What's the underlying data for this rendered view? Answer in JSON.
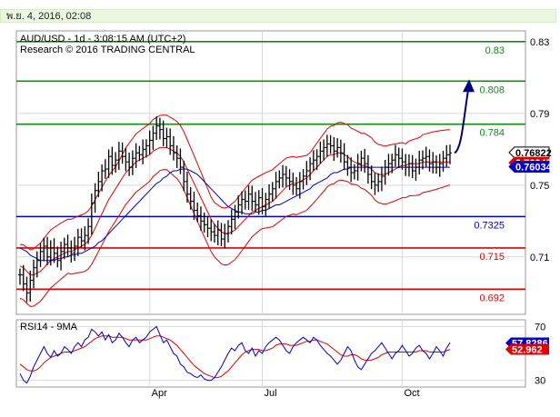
{
  "header": {
    "date": "พ.ย. 4, 2016, 02:08"
  },
  "chart_data": [
    {
      "type": "line",
      "title": "AUD/USD - 1d - 3:08:15 AM (UTC+2)",
      "subtitle": "Research © 2016 TRADING CENTRAL",
      "ylim": [
        0.678,
        0.836
      ],
      "yticks": [
        "0.83",
        "0.79",
        "0.75",
        "0.71"
      ],
      "yticks_values": [
        0.83,
        0.79,
        0.75,
        0.71
      ],
      "xticks": [
        "Apr",
        "Jul",
        "Oct"
      ],
      "levels": [
        {
          "label": "0.83",
          "value": 0.83,
          "color": "#138a13"
        },
        {
          "label": "0.808",
          "value": 0.808,
          "color": "#138a13"
        },
        {
          "label": "0.784",
          "value": 0.784,
          "color": "#138a13"
        },
        {
          "label": "0.7325",
          "value": 0.7325,
          "color": "#0000c8"
        },
        {
          "label": "0.715",
          "value": 0.715,
          "color": "#e00000"
        },
        {
          "label": "0.692",
          "value": 0.692,
          "color": "#e00000"
        }
      ],
      "price_labels": [
        {
          "label": "0.76822",
          "value": 0.7682,
          "bg": "#ffffff",
          "fg": "#000000"
        },
        {
          "label": "0.76247",
          "value": 0.7625,
          "bg": "#e00000",
          "fg": "#ffffff"
        },
        {
          "label": "0.76034",
          "value": 0.7603,
          "bg": "#0000c8",
          "fg": "#ffffff"
        }
      ],
      "price_closes": [
        0.7,
        0.695,
        0.69,
        0.697,
        0.704,
        0.708,
        0.713,
        0.716,
        0.71,
        0.715,
        0.712,
        0.708,
        0.713,
        0.717,
        0.715,
        0.712,
        0.716,
        0.721,
        0.719,
        0.722,
        0.727,
        0.74,
        0.747,
        0.752,
        0.758,
        0.759,
        0.766,
        0.761,
        0.764,
        0.769,
        0.766,
        0.763,
        0.76,
        0.765,
        0.768,
        0.767,
        0.77,
        0.772,
        0.775,
        0.779,
        0.783,
        0.781,
        0.776,
        0.777,
        0.772,
        0.768,
        0.765,
        0.76,
        0.752,
        0.745,
        0.741,
        0.736,
        0.733,
        0.73,
        0.728,
        0.726,
        0.724,
        0.722,
        0.725,
        0.72,
        0.723,
        0.727,
        0.731,
        0.735,
        0.739,
        0.742,
        0.741,
        0.745,
        0.741,
        0.739,
        0.743,
        0.738,
        0.742,
        0.745,
        0.748,
        0.752,
        0.754,
        0.756,
        0.754,
        0.752,
        0.75,
        0.748,
        0.752,
        0.755,
        0.758,
        0.762,
        0.764,
        0.766,
        0.769,
        0.771,
        0.773,
        0.772,
        0.769,
        0.771,
        0.768,
        0.763,
        0.76,
        0.757,
        0.758,
        0.762,
        0.765,
        0.762,
        0.756,
        0.752,
        0.75,
        0.752,
        0.755,
        0.76,
        0.762,
        0.764,
        0.767,
        0.765,
        0.763,
        0.76,
        0.762,
        0.758,
        0.76,
        0.764,
        0.765,
        0.766,
        0.762,
        0.763,
        0.76,
        0.762,
        0.765,
        0.767,
        0.768
      ],
      "ma_fast": [
        0.705,
        0.704,
        0.702,
        0.7,
        0.7,
        0.701,
        0.702,
        0.704,
        0.706,
        0.708,
        0.709,
        0.71,
        0.711,
        0.712,
        0.713,
        0.713,
        0.714,
        0.715,
        0.716,
        0.717,
        0.719,
        0.722,
        0.726,
        0.73,
        0.734,
        0.738,
        0.742,
        0.745,
        0.748,
        0.751,
        0.754,
        0.757,
        0.759,
        0.761,
        0.763,
        0.764,
        0.765,
        0.766,
        0.767,
        0.769,
        0.77,
        0.771,
        0.771,
        0.771,
        0.77,
        0.769,
        0.768,
        0.766,
        0.763,
        0.759,
        0.755,
        0.751,
        0.747,
        0.743,
        0.739,
        0.735,
        0.731,
        0.728,
        0.726,
        0.724,
        0.723,
        0.723,
        0.724,
        0.725,
        0.727,
        0.729,
        0.731,
        0.733,
        0.735,
        0.736,
        0.737,
        0.738,
        0.739,
        0.74,
        0.741,
        0.743,
        0.745,
        0.747,
        0.749,
        0.75,
        0.751,
        0.751,
        0.752,
        0.753,
        0.754,
        0.756,
        0.758,
        0.76,
        0.762,
        0.764,
        0.766,
        0.767,
        0.767,
        0.768,
        0.768,
        0.767,
        0.766,
        0.764,
        0.763,
        0.762,
        0.761,
        0.761,
        0.76,
        0.759,
        0.757,
        0.756,
        0.756,
        0.756,
        0.757,
        0.758,
        0.759,
        0.76,
        0.761,
        0.761,
        0.762,
        0.762,
        0.762,
        0.762,
        0.763,
        0.763,
        0.763,
        0.763,
        0.763,
        0.763,
        0.763,
        0.763,
        0.763
      ],
      "ma_slow": [
        0.715,
        0.714,
        0.713,
        0.711,
        0.71,
        0.709,
        0.708,
        0.708,
        0.708,
        0.708,
        0.708,
        0.709,
        0.709,
        0.71,
        0.71,
        0.711,
        0.711,
        0.712,
        0.712,
        0.713,
        0.714,
        0.715,
        0.716,
        0.718,
        0.719,
        0.721,
        0.723,
        0.725,
        0.727,
        0.729,
        0.731,
        0.733,
        0.735,
        0.737,
        0.739,
        0.741,
        0.743,
        0.745,
        0.747,
        0.749,
        0.751,
        0.752,
        0.754,
        0.755,
        0.757,
        0.758,
        0.758,
        0.759,
        0.759,
        0.759,
        0.758,
        0.757,
        0.756,
        0.754,
        0.752,
        0.75,
        0.748,
        0.746,
        0.744,
        0.742,
        0.74,
        0.738,
        0.737,
        0.736,
        0.735,
        0.735,
        0.734,
        0.734,
        0.734,
        0.735,
        0.735,
        0.736,
        0.736,
        0.737,
        0.738,
        0.739,
        0.739,
        0.74,
        0.741,
        0.742,
        0.743,
        0.744,
        0.745,
        0.746,
        0.747,
        0.748,
        0.75,
        0.751,
        0.752,
        0.753,
        0.754,
        0.756,
        0.757,
        0.757,
        0.758,
        0.759,
        0.759,
        0.76,
        0.76,
        0.76,
        0.76,
        0.76,
        0.76,
        0.76,
        0.76,
        0.76,
        0.76,
        0.76,
        0.76,
        0.76,
        0.76,
        0.76,
        0.76,
        0.76,
        0.76,
        0.76,
        0.76,
        0.76,
        0.76,
        0.76,
        0.76,
        0.76,
        0.76,
        0.76,
        0.76,
        0.76,
        0.76
      ],
      "forecast_arrow": {
        "from": 0.768,
        "to": 0.808
      }
    },
    {
      "type": "line",
      "title": "RSI14 - 9MA",
      "ylim": [
        25,
        75
      ],
      "yticks": [
        "70",
        "30"
      ],
      "yticks_values": [
        70,
        30
      ],
      "value_labels": [
        {
          "label": "57.8286",
          "value": 57.8,
          "bg": "#0000c8",
          "fg": "#ffffff"
        },
        {
          "label": "52.962",
          "value": 53.0,
          "bg": "#e00000",
          "fg": "#ffffff"
        }
      ],
      "rsi": [
        35,
        30,
        28,
        33,
        40,
        45,
        50,
        55,
        50,
        47,
        52,
        48,
        50,
        55,
        53,
        50,
        55,
        58,
        55,
        60,
        62,
        68,
        66,
        63,
        66,
        60,
        64,
        58,
        60,
        65,
        62,
        58,
        55,
        60,
        62,
        58,
        60,
        62,
        66,
        68,
        70,
        64,
        58,
        60,
        55,
        50,
        48,
        42,
        40,
        36,
        35,
        33,
        32,
        34,
        31,
        30,
        30,
        32,
        36,
        40,
        45,
        50,
        54,
        52,
        56,
        58,
        52,
        50,
        54,
        48,
        52,
        50,
        55,
        58,
        60,
        62,
        60,
        56,
        52,
        50,
        55,
        58,
        60,
        62,
        60,
        58,
        62,
        60,
        56,
        53,
        50,
        48,
        45,
        42,
        45,
        50,
        55,
        52,
        45,
        40,
        38,
        42,
        46,
        50,
        52,
        55,
        58,
        54,
        50,
        46,
        50,
        52,
        56,
        52,
        48,
        50,
        54,
        56,
        52,
        50,
        46,
        50,
        55,
        52,
        48,
        54,
        58
      ],
      "rsi_ma": [
        42,
        40,
        38,
        37,
        37,
        38,
        40,
        43,
        45,
        47,
        48,
        49,
        50,
        51,
        51,
        51,
        52,
        53,
        54,
        55,
        57,
        59,
        61,
        62,
        63,
        63,
        63,
        62,
        62,
        62,
        62,
        61,
        60,
        60,
        60,
        60,
        60,
        60,
        61,
        62,
        63,
        63,
        62,
        61,
        60,
        58,
        56,
        53,
        50,
        47,
        44,
        41,
        39,
        37,
        35,
        34,
        33,
        32,
        32,
        33,
        35,
        37,
        40,
        43,
        46,
        49,
        51,
        52,
        53,
        53,
        53,
        52,
        52,
        53,
        54,
        56,
        57,
        57,
        57,
        56,
        56,
        56,
        57,
        58,
        59,
        59,
        60,
        60,
        59,
        58,
        57,
        55,
        53,
        51,
        49,
        48,
        48,
        49,
        49,
        48,
        46,
        45,
        45,
        45,
        46,
        47,
        49,
        50,
        51,
        51,
        51,
        51,
        51,
        51,
        51,
        51,
        51,
        52,
        52,
        52,
        51,
        51,
        51,
        51,
        51,
        52,
        53
      ]
    }
  ]
}
